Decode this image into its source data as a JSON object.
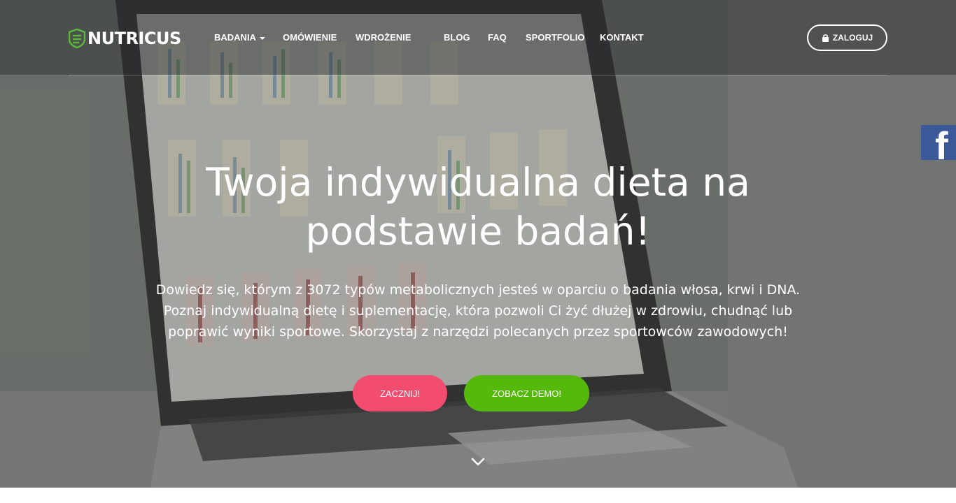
{
  "brand": {
    "name": "NUTRICUS"
  },
  "nav": {
    "items": [
      {
        "label": "BADANIA",
        "has_dropdown": true
      },
      {
        "label": "OMÓWIENIE"
      },
      {
        "label": "WDROŻENIE"
      },
      {
        "label": "BLOG"
      },
      {
        "label": "FAQ"
      },
      {
        "label": "SPORTFOLIO"
      },
      {
        "label": "KONTAKT"
      }
    ],
    "login_label": "ZALOGUJ"
  },
  "social": {
    "facebook_glyph": "f"
  },
  "hero": {
    "headline_line1": "Twoja indywidualna dieta na",
    "headline_line2": "podstawie badań!",
    "subtext": "Dowiedz się, którym z 3072 typów metabolicznych jesteś w oparciu o badania włosa, krwi i DNA. Poznaj indywidualną dietę i suplementację, która pozwoli Ci żyć dłużej w zdrowiu, chudnąć lub poprawić wyniki sportowe. Skorzystaj z narzędzi polecanych przez sportowców zawodowych!",
    "cta_start": "ZACZNIJ!",
    "cta_demo": "ZOBACZ DEMO!"
  },
  "icons": {
    "logo": "shield-logo-icon",
    "login": "lock-icon",
    "facebook": "facebook-icon",
    "scroll": "chevron-down-icon"
  },
  "colors": {
    "brand_green": "#5cb83c",
    "cta_start": "#f24c6f",
    "cta_demo": "#55b90c",
    "facebook": "#3b5998"
  }
}
